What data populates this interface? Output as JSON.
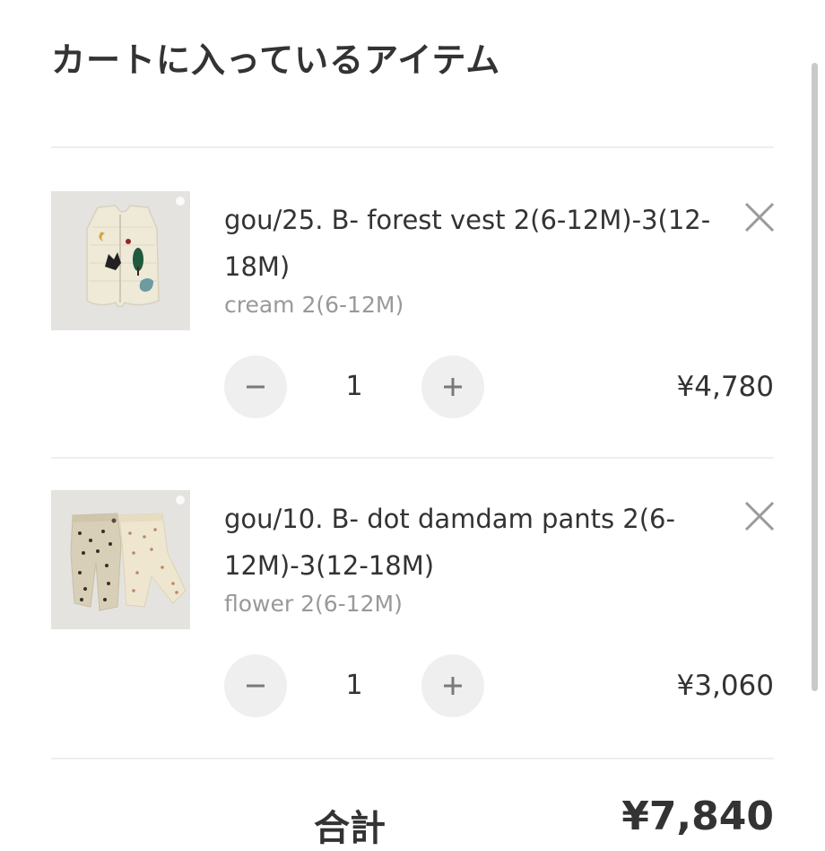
{
  "page": {
    "title": "カートに入っているアイテム"
  },
  "items": [
    {
      "name": "gou/25. B- forest vest 2(6-12M)-3(12-18M)",
      "variant": "cream 2(6-12M)",
      "quantity": "1",
      "price": "¥4,780"
    },
    {
      "name": "gou/10. B- dot damdam pants 2(6-12M)-3(12-18M)",
      "variant": "flower 2(6-12M)",
      "quantity": "1",
      "price": "¥3,060"
    }
  ],
  "summary": {
    "total_label": "合計",
    "total_value": "¥7,840"
  },
  "icons": {
    "remove": "close-icon",
    "decrease": "minus-icon",
    "increase": "plus-icon"
  },
  "colors": {
    "text": "#333333",
    "muted": "#999999",
    "button_bg": "#efefef",
    "divider": "#eeeeee"
  }
}
